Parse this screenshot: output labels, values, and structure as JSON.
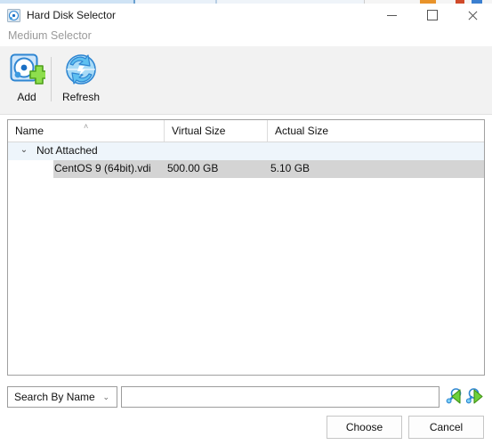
{
  "window": {
    "title": "Hard Disk Selector",
    "icon": "hard-disk-icon",
    "controls": {
      "minimize": "minimize-icon",
      "maximize": "maximize-icon",
      "close": "close-icon"
    }
  },
  "subtitle": "Medium Selector",
  "toolbar": {
    "items": [
      {
        "label": "Add",
        "icon": "add-hard-disk-icon"
      },
      {
        "label": "Refresh",
        "icon": "refresh-icon"
      }
    ]
  },
  "list": {
    "columns": [
      {
        "label": "Name",
        "sort_indicator": "˄"
      },
      {
        "label": "Virtual Size"
      },
      {
        "label": "Actual Size"
      }
    ],
    "groups": [
      {
        "label": "Not Attached",
        "expanded": true,
        "chevron": "⌄",
        "rows": [
          {
            "name": "CentOS 9 (64bit).vdi",
            "virtual_size": "500.00 GB",
            "actual_size": "5.10 GB",
            "selected": true
          }
        ]
      }
    ]
  },
  "search": {
    "mode_label": "Search By Name",
    "mode_chevron": "⌄",
    "value": "",
    "placeholder": "",
    "prev_icon": "search-previous-icon",
    "next_icon": "search-next-icon"
  },
  "buttons": {
    "choose": "Choose",
    "cancel": "Cancel"
  },
  "colors": {
    "selection": "#d4d4d4",
    "group_row": "#eef5fb",
    "toolbar_bg": "#f2f2f2",
    "panel_border": "#a0a0a0"
  }
}
